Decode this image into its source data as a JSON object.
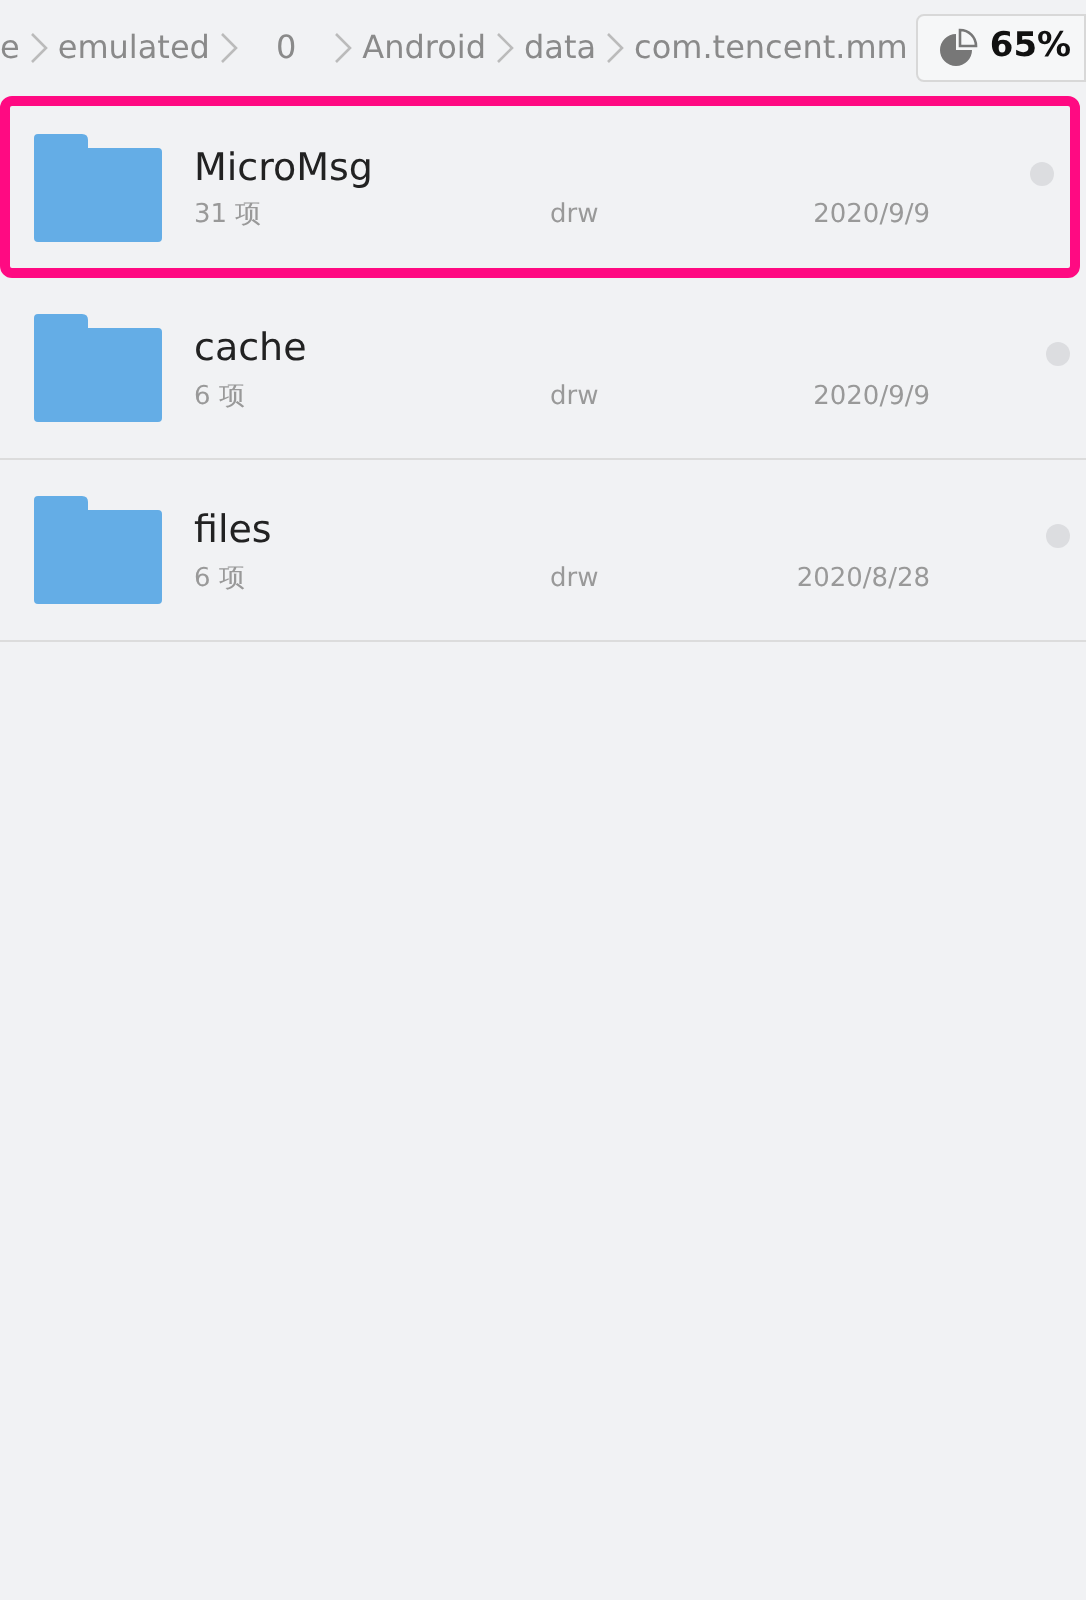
{
  "breadcrumb": [
    "e",
    "emulated",
    "0",
    "Android",
    "data",
    "com.tencent.mm"
  ],
  "storage": {
    "reading": "65%"
  },
  "files": [
    {
      "name": "MicroMsg",
      "count": "31 项",
      "perms": "drw",
      "date": "2020/9/9",
      "selected": false,
      "highlighted": true
    },
    {
      "name": "cache",
      "count": "6 项",
      "perms": "drw",
      "date": "2020/9/9",
      "selected": false,
      "highlighted": false
    },
    {
      "name": "files",
      "count": "6 项",
      "perms": "drw",
      "date": "2020/8/28",
      "selected": false,
      "highlighted": false
    }
  ]
}
